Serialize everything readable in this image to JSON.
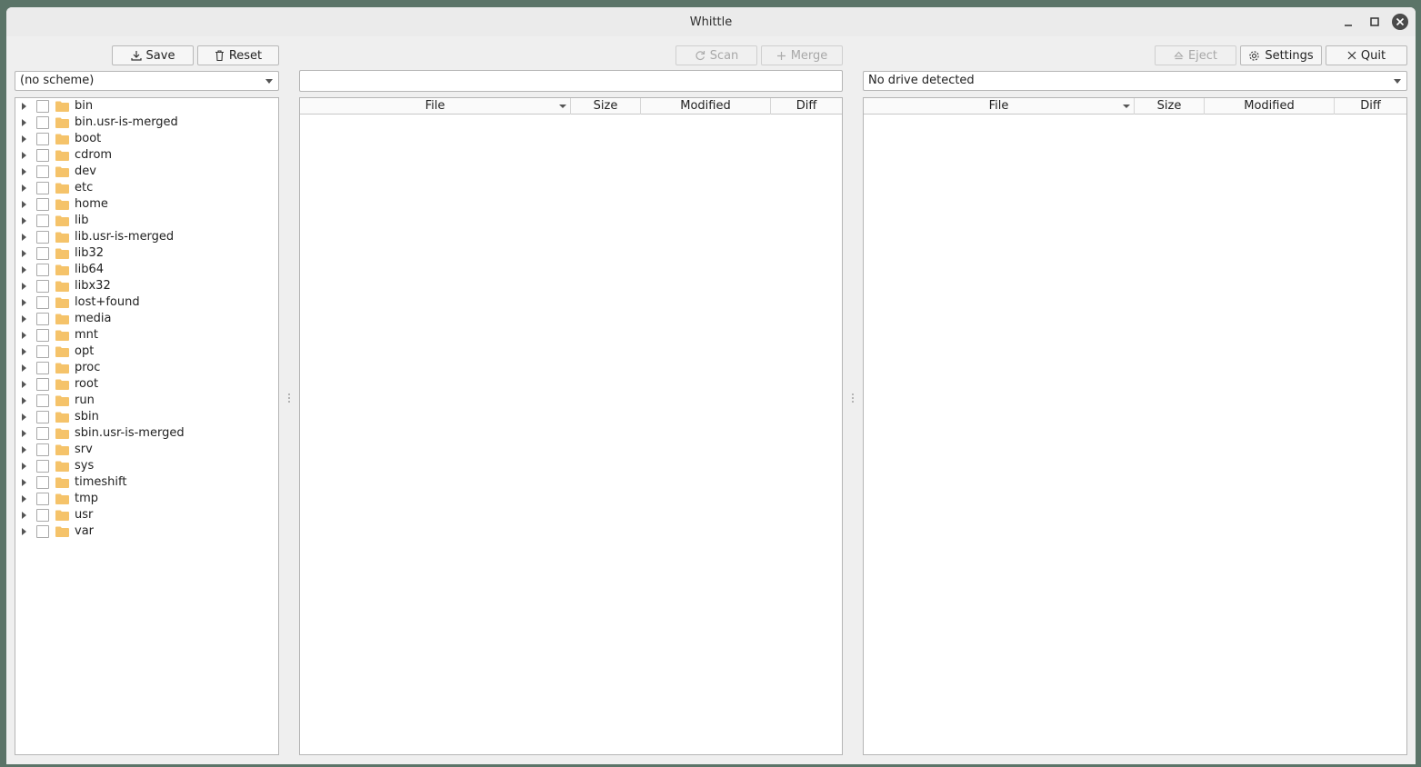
{
  "window": {
    "title": "Whittle"
  },
  "left": {
    "save_label": "Save",
    "reset_label": "Reset",
    "scheme": "(no scheme)",
    "tree": [
      "bin",
      "bin.usr-is-merged",
      "boot",
      "cdrom",
      "dev",
      "etc",
      "home",
      "lib",
      "lib.usr-is-merged",
      "lib32",
      "lib64",
      "libx32",
      "lost+found",
      "media",
      "mnt",
      "opt",
      "proc",
      "root",
      "run",
      "sbin",
      "sbin.usr-is-merged",
      "srv",
      "sys",
      "timeshift",
      "tmp",
      "usr",
      "var"
    ]
  },
  "middle": {
    "scan_label": "Scan",
    "merge_label": "Merge",
    "path_value": "",
    "columns": [
      "File",
      "Size",
      "Modified",
      "Diff"
    ]
  },
  "right": {
    "eject_label": "Eject",
    "settings_label": "Settings",
    "quit_label": "Quit",
    "drive": "No drive detected",
    "columns": [
      "File",
      "Size",
      "Modified",
      "Diff"
    ]
  },
  "colors": {
    "folder": "#f5c36a",
    "background": "#efefef",
    "desktop": "#5b7468"
  }
}
